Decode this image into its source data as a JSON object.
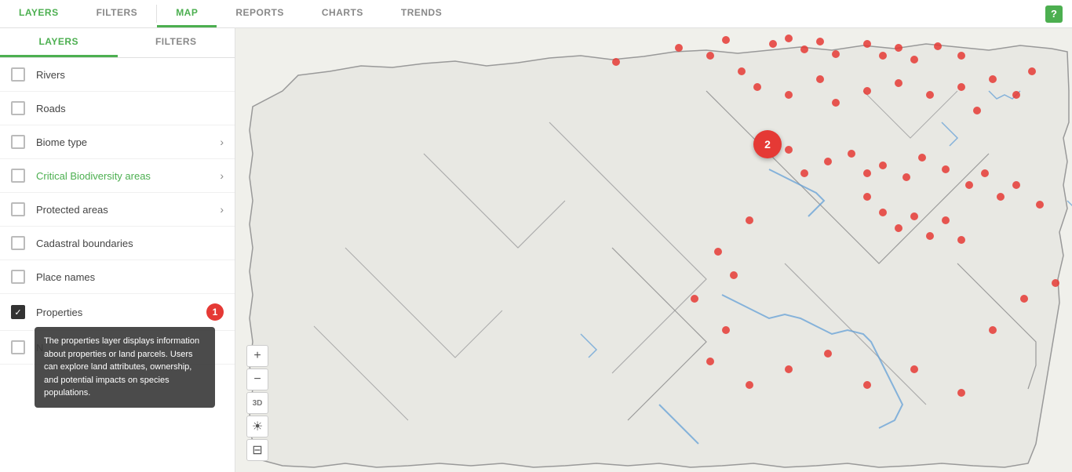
{
  "nav": {
    "items": [
      {
        "id": "layers",
        "label": "LAYERS",
        "active": false
      },
      {
        "id": "filters",
        "label": "FILTERS",
        "active": false
      },
      {
        "id": "map",
        "label": "MAP",
        "active": true
      },
      {
        "id": "reports",
        "label": "REPORTS",
        "active": false
      },
      {
        "id": "charts",
        "label": "CHARTS",
        "active": false
      },
      {
        "id": "trends",
        "label": "TRENDS",
        "active": false
      }
    ],
    "help_label": "?"
  },
  "sidebar": {
    "tabs": [
      {
        "id": "layers",
        "label": "LAYERS",
        "active": true
      },
      {
        "id": "filters",
        "label": "FILTERS",
        "active": false
      }
    ],
    "layers": [
      {
        "id": "rivers",
        "label": "Rivers",
        "checked": false,
        "has_chevron": false,
        "green": false
      },
      {
        "id": "roads",
        "label": "Roads",
        "checked": false,
        "has_chevron": false,
        "green": false
      },
      {
        "id": "biome_type",
        "label": "Biome type",
        "checked": false,
        "has_chevron": true,
        "green": false
      },
      {
        "id": "critical_biodiversity",
        "label": "Critical Biodiversity areas",
        "checked": false,
        "has_chevron": true,
        "green": true
      },
      {
        "id": "protected_areas",
        "label": "Protected areas",
        "checked": false,
        "has_chevron": true,
        "green": false
      },
      {
        "id": "cadastral_boundaries",
        "label": "Cadastral boundaries",
        "checked": false,
        "has_chevron": false,
        "green": false
      },
      {
        "id": "place_names",
        "label": "Place names",
        "checked": false,
        "has_chevron": false,
        "green": false
      },
      {
        "id": "properties",
        "label": "Properties",
        "checked": true,
        "has_chevron": false,
        "green": false,
        "badge": "1"
      },
      {
        "id": "next_layer",
        "label": "N",
        "checked": false,
        "has_chevron": false,
        "green": false
      }
    ],
    "tooltip": "The properties layer displays information about properties or land parcels. Users can explore land attributes, ownership, and potential impacts on species populations."
  },
  "map": {
    "cluster_badge": "2",
    "controls": [
      {
        "id": "zoom_in",
        "label": "+"
      },
      {
        "id": "zoom_out",
        "label": "−"
      },
      {
        "id": "3d",
        "label": "3D"
      },
      {
        "id": "brightness",
        "label": "☀"
      },
      {
        "id": "print",
        "label": "⊟"
      }
    ]
  }
}
